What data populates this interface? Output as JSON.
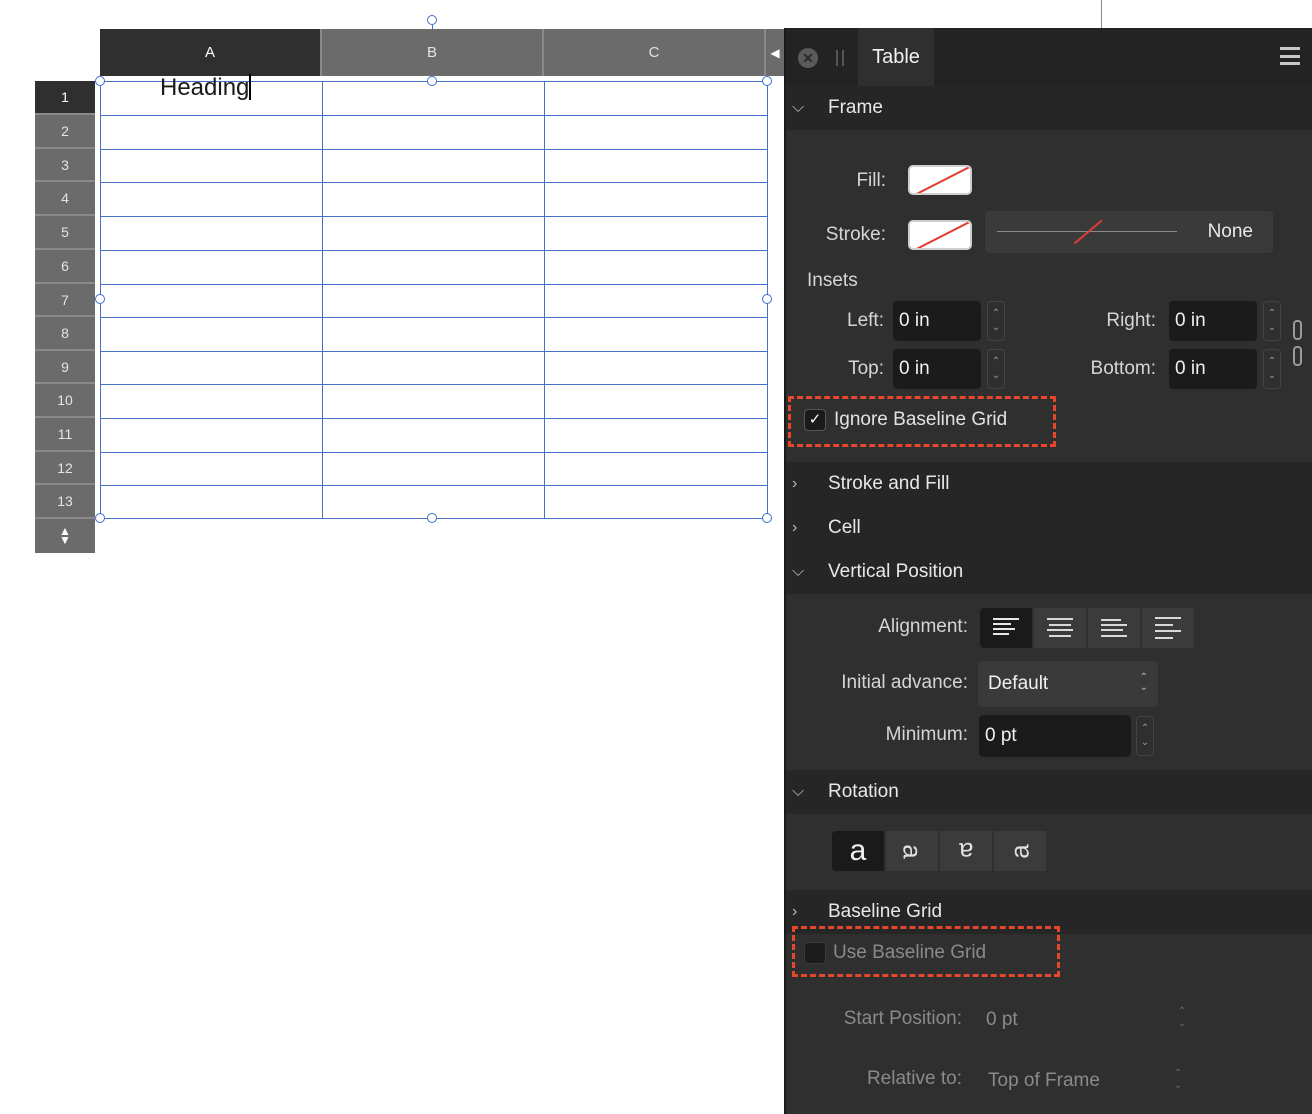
{
  "table": {
    "columns": [
      "A",
      "B",
      "C"
    ],
    "rows": [
      "1",
      "2",
      "3",
      "4",
      "5",
      "6",
      "7",
      "8",
      "9",
      "10",
      "11",
      "12",
      "13"
    ],
    "cell_a1": "Heading"
  },
  "panel": {
    "tab_label": "Table",
    "sections": {
      "frame": "Frame",
      "stroke_fill": "Stroke and Fill",
      "cell": "Cell",
      "vertical_position": "Vertical Position",
      "rotation": "Rotation",
      "baseline_grid": "Baseline Grid"
    },
    "frame": {
      "fill_label": "Fill:",
      "stroke_label": "Stroke:",
      "stroke_style": "None",
      "insets_label": "Insets",
      "left_label": "Left:",
      "left_value": "0 in",
      "right_label": "Right:",
      "right_value": "0 in",
      "top_label": "Top:",
      "top_value": "0 in",
      "bottom_label": "Bottom:",
      "bottom_value": "0 in",
      "ignore_baseline": "Ignore Baseline Grid",
      "ignore_baseline_checked": true
    },
    "vertical": {
      "alignment_label": "Alignment:",
      "initial_advance_label": "Initial advance:",
      "initial_advance_value": "Default",
      "minimum_label": "Minimum:",
      "minimum_value": "0 pt"
    },
    "rotation": {
      "glyphs": [
        "a",
        "ꝺ",
        "ɐ",
        "ɑ"
      ]
    },
    "baseline": {
      "use_baseline": "Use Baseline Grid",
      "use_baseline_checked": false,
      "start_label": "Start Position:",
      "start_value": "0 pt",
      "relative_label": "Relative to:",
      "relative_value": "Top of Frame"
    }
  },
  "colors": {
    "selection_blue": "#4a72c4",
    "highlight_dash": "#e8452d"
  }
}
